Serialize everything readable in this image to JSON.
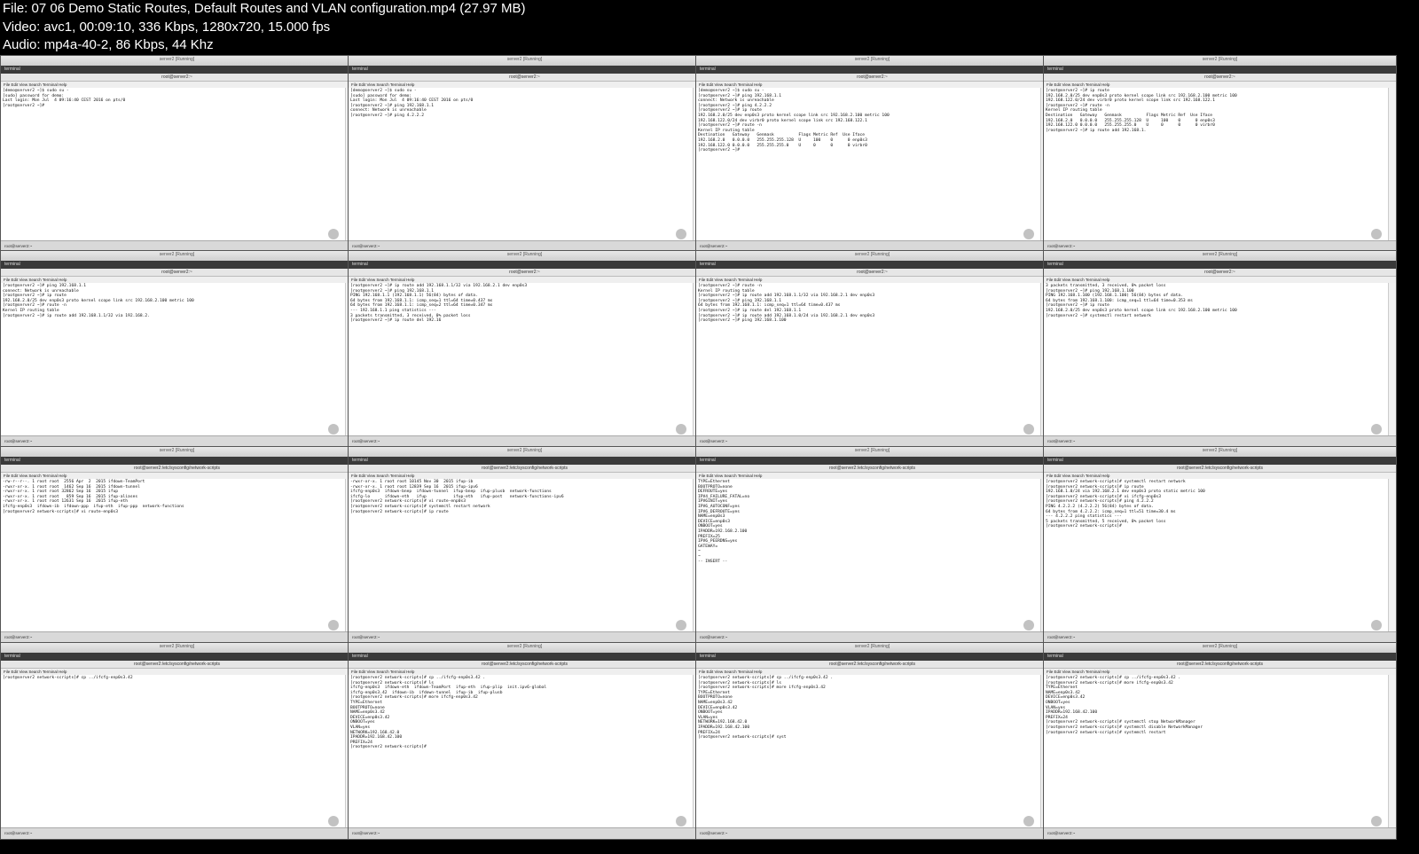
{
  "header": {
    "file_line": "File: 07 06 Demo Static Routes, Default Routes and VLAN configuration.mp4 (27.97 MB)",
    "video_line": "Video: avc1, 00:09:10, 336 Kbps, 1280x720, 15.000 fps",
    "audio_line": "Audio: mp4a-40-2, 86 Kbps, 44 Khz"
  },
  "tiles": [
    {
      "title": "root@server2:~",
      "tab": "terminal",
      "lines": "[demo@server2 ~]$ sudo su -\n[sudo] password for demo:\nLast login: Mon Jul  4 09:16:40 CEST 2016 on pts/0\n[root@server2 ~]#"
    },
    {
      "title": "root@server2:~",
      "tab": "terminal",
      "lines": "[demo@server2 ~]$ sudo su -\n[sudo] password for demo:\nLast login: Mon Jul  4 09:16:40 CEST 2016 on pts/0\n[root@server2 ~]# ping 192.168.1.1\nconnect: Network is unreachable\n[root@server2 ~]# ping 4.2.2.2"
    },
    {
      "title": "root@server2:~",
      "tab": "terminal",
      "lines": "[demo@server2 ~]$ sudo su -\n[root@server2 ~]# ping 192.168.1.1\nconnect: Network is unreachable\n[root@server2 ~]# ping 4.2.2.2\n[root@server2 ~]# ip route\n192.168.2.0/25 dev enp0s3 proto kernel scope link src 192.168.2.100 metric 100\n192.168.122.0/24 dev virbr0 proto kernel scope link src 192.168.122.1\n[root@server2 ~]# route -n\nKernel IP routing table\nDestination   Gateway   Genmask          Flags Metric Ref  Use Iface\n192.168.2.0   0.0.0.0   255.255.255.128  U     100    0      0 enp0s3\n192.168.122.0 0.0.0.0   255.255.255.0    U     0      0      0 virbr0\n[root@server2 ~]#"
    },
    {
      "title": "root@server2:~",
      "tab": "terminal",
      "lines": "[root@server2 ~]# ip route\n192.168.2.0/25 dev enp0s3 proto kernel scope link src 192.168.2.100 metric 100\n192.168.122.0/24 dev virbr0 proto kernel scope link src 192.168.122.1\n[root@server2 ~]# route -n\nKernel IP routing table\nDestination   Gateway   Genmask          Flags Metric Ref  Use Iface\n192.168.2.0   0.0.0.0   255.255.255.128  U     100    0      0 enp0s3\n192.168.122.0 0.0.0.0   255.255.255.0    U     0      0      0 virbr0\n[root@server2 ~]# ip route add 192.168.1."
    },
    {
      "title": "root@server2:~",
      "tab": "terminal",
      "lines": "[root@server2 ~]# ping 192.168.1.1\nconnect: Network is unreachable\n[root@server2 ~]# ip route\n192.168.2.0/25 dev enp0s3 proto kernel scope link src 192.168.2.100 metric 100\n[root@server2 ~]# route -n\nKernel IP routing table\n[root@server2 ~]# ip route add 192.168.1.1/32 via 192.168.2."
    },
    {
      "title": "root@server2:~",
      "tab": "terminal",
      "lines": "[root@server2 ~]# ip route add 192.168.1.1/32 via 192.168.2.1 dev enp0s3\n[root@server2 ~]# ping 192.168.1.1\nPING 192.168.1.1 (192.168.1.1) 56(84) bytes of data.\n64 bytes from 192.168.1.1: icmp_seq=1 ttl=64 time=0.437 ms\n64 bytes from 192.168.1.1: icmp_seq=2 ttl=64 time=0.347 ms\n--- 192.168.1.1 ping statistics ---\n3 packets transmitted, 3 received, 0% packet loss\n[root@server2 ~]# ip route del 192.16"
    },
    {
      "title": "root@server2:~",
      "tab": "terminal",
      "lines": "[root@server2 ~]# route -n\nKernel IP routing table\n[root@server2 ~]# ip route add 192.168.1.1/32 via 192.168.2.1 dev enp0s3\n[root@server2 ~]# ping 192.168.1.1\n64 bytes from 192.168.1.1: icmp_seq=1 ttl=64 time=0.437 ms\n[root@server2 ~]# ip route del 192.168.1.1\n[root@server2 ~]# ip route add 192.168.1.0/24 via 192.168.2.1 dev enp0s3\n[root@server2 ~]# ping 192.168.1.100"
    },
    {
      "title": "root@server2:~",
      "tab": "terminal",
      "lines": "3 packets transmitted, 3 received, 0% packet loss\n[root@server2 ~]# ping 192.168.1.100\nPING 192.168.1.100 (192.168.1.100) 56(84) bytes of data.\n64 bytes from 192.168.1.100: icmp_seq=1 ttl=64 time=0.353 ms\n[root@server2 ~]# ip route\n192.168.2.0/25 dev enp0s3 proto kernel scope link src 192.168.2.100 metric 100\n[root@server2 ~]# systemctl restart network"
    },
    {
      "title": "root@server2:/etc/sysconfig/network-scripts",
      "tab": "terminal",
      "lines": "-rw-r--r--. 1 root root  2556 Apr  2  2015 ifdown-TeamPort\n-rwxr-xr-x. 1 root root  1462 Sep 16  2015 ifdown-tunnel\n-rwxr-xr-x. 1 root root 32862 Sep 16  2015 ifup\n-rwxr-xr-x. 1 root root   859 Sep 16  2015 ifup-aliases\n-rwxr-xr-x. 1 root root 12631 Sep 16  2015 ifup-eth\nifcfg-enp0s3  ifdown-ib  ifdown-ppp  ifup-eth  ifup-ppp  network-functions\n[root@server2 network-scripts]# vi route-enp0s3"
    },
    {
      "title": "root@server2:/etc/sysconfig/network-scripts",
      "tab": "terminal",
      "lines": "-rwxr-xr-x. 1 root root 10145 Nov 30  2015 ifup-ib\n-rwxr-xr-x. 1 root root 12839 Sep 16  2015 ifup-ipv6\nifcfg-enp0s3  ifdown-bnep  ifdown-tunnel  ifup-bnep  ifup-plusb  network-functions\nifcfg-lo      ifdown-eth   ifup           ifup-eth   ifup-post   network-functions-ipv6\n[root@server2 network-scripts]# vi route-enp0s3\n[root@server2 network-scripts]# systemctl restart network\n[root@server2 network-scripts]# ip route"
    },
    {
      "title": "root@server2:/etc/sysconfig/network-scripts",
      "tab": "terminal",
      "lines": "TYPE=Ethernet\nBOOTPROTO=none\nDEFROUTE=yes\nIPV4_FAILURE_FATAL=no\nIPV6INIT=yes\nIPV6_AUTOCONF=yes\nIPV6_DEFROUTE=yes\nNAME=enp0s3\nDEVICE=enp0s3\nONBOOT=yes\nIPADDR=192.168.2.100\nPREFIX=25\nIPV6_PEERDNS=yes\nGATEWAY=\n~\n~\n-- INSERT --"
    },
    {
      "title": "root@server2:/etc/sysconfig/network-scripts",
      "tab": "terminal",
      "lines": "[root@server2 network-scripts]# systemctl restart network\n[root@server2 network-scripts]# ip route\n192.168.1.0/24 via 192.168.2.1 dev enp0s3 proto static metric 100\n[root@server2 network-scripts]# vi ifcfg-enp0s3\n[root@server2 network-scripts]# ping 4.2.2.2\nPING 4.2.2.2 (4.2.2.2) 56(84) bytes of data.\n64 bytes from 4.2.2.2: icmp_seq=1 ttl=51 time=30.4 ms\n--- 4.2.2.2 ping statistics ---\n5 packets transmitted, 5 received, 0% packet loss\n[root@server2 network-scripts]#"
    },
    {
      "title": "root@server2:/etc/sysconfig/network-scripts",
      "tab": "terminal",
      "lines": "[root@server2 network-scripts]# cp ../ifcfg-enp0s3.42"
    },
    {
      "title": "root@server2:/etc/sysconfig/network-scripts",
      "tab": "terminal",
      "lines": "[root@server2 network-scripts]# cp ../ifcfg-enp0s3.42 .\n[root@server2 network-scripts]# ls\nifcfg-enp0s3  ifdown-eth  ifdown-TeamPort  ifup-eth  ifup-plip  init.ipv6-global\nifcfg-enp0s3.42  ifdown-ib  ifdown-tunnel  ifup-ib  ifup-plusb\n[root@server2 network-scripts]# more ifcfg-enp0s3.42\nTYPE=Ethernet\nBOOTPROTO=none\nNAME=enp0s3.42\nDEVICE=enp0s3.42\nONBOOT=yes\nVLAN=yes\nNETWORK=192.168.42.0\nIPADDR=192.168.42.100\nPREFIX=24\n[root@server2 network-scripts]#"
    },
    {
      "title": "root@server2:/etc/sysconfig/network-scripts",
      "tab": "terminal",
      "lines": "[root@server2 network-scripts]# cp ../ifcfg-enp0s3.42 .\n[root@server2 network-scripts]# ls\n[root@server2 network-scripts]# more ifcfg-enp0s3.42\nTYPE=Ethernet\nBOOTPROTO=none\nNAME=enp0s3.42\nDEVICE=enp0s3.42\nONBOOT=yes\nVLAN=yes\nNETWORK=192.168.42.0\nIPADDR=192.168.42.100\nPREFIX=24\n[root@server2 network-scripts]# syst"
    },
    {
      "title": "root@server2:/etc/sysconfig/network-scripts",
      "tab": "terminal",
      "lines": "[root@server2 network-scripts]# cp ../ifcfg-enp0s3.42 .\n[root@server2 network-scripts]# more ifcfg-enp0s3.42\nTYPE=Ethernet\nNAME=enp0s3.42\nDEVICE=enp0s3.42\nONBOOT=yes\nVLAN=yes\nIPADDR=192.168.42.100\nPREFIX=24\n[root@server2 network-scripts]# systemctl stop NetworkManager\n[root@server2 network-scripts]# systemctl disable NetworkManager\n[root@server2 network-scripts]# systemctl restart"
    }
  ],
  "vm_title": "server2 [Running]",
  "menu": "File  Edit  View  Search  Terminal  Help",
  "taskbar": "root@server2:~"
}
